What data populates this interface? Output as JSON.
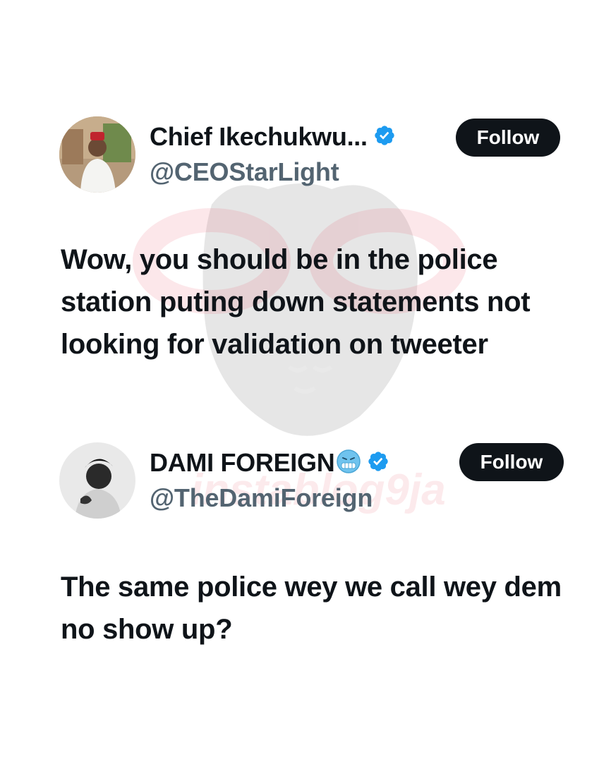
{
  "tweets": [
    {
      "display_name": "Chief Ikechukwu...",
      "handle": "@CEOStarLight",
      "follow_label": "Follow",
      "text": "Wow, you should be in the police station puting down statements not looking for validation on tweeter"
    },
    {
      "display_name": "DAMI FOREIGN",
      "handle": "@TheDamiForeign",
      "follow_label": "Follow",
      "text": "The same police wey we call wey dem no show up?"
    }
  ],
  "watermark_text": "instablog9ja",
  "colors": {
    "text": "#0f1419",
    "handle": "#536471",
    "verified": "#1d9bf0",
    "button": "#0f1419"
  },
  "icons": {
    "verified": "verified-badge-icon",
    "emoji": "cold-face-emoji-icon"
  }
}
